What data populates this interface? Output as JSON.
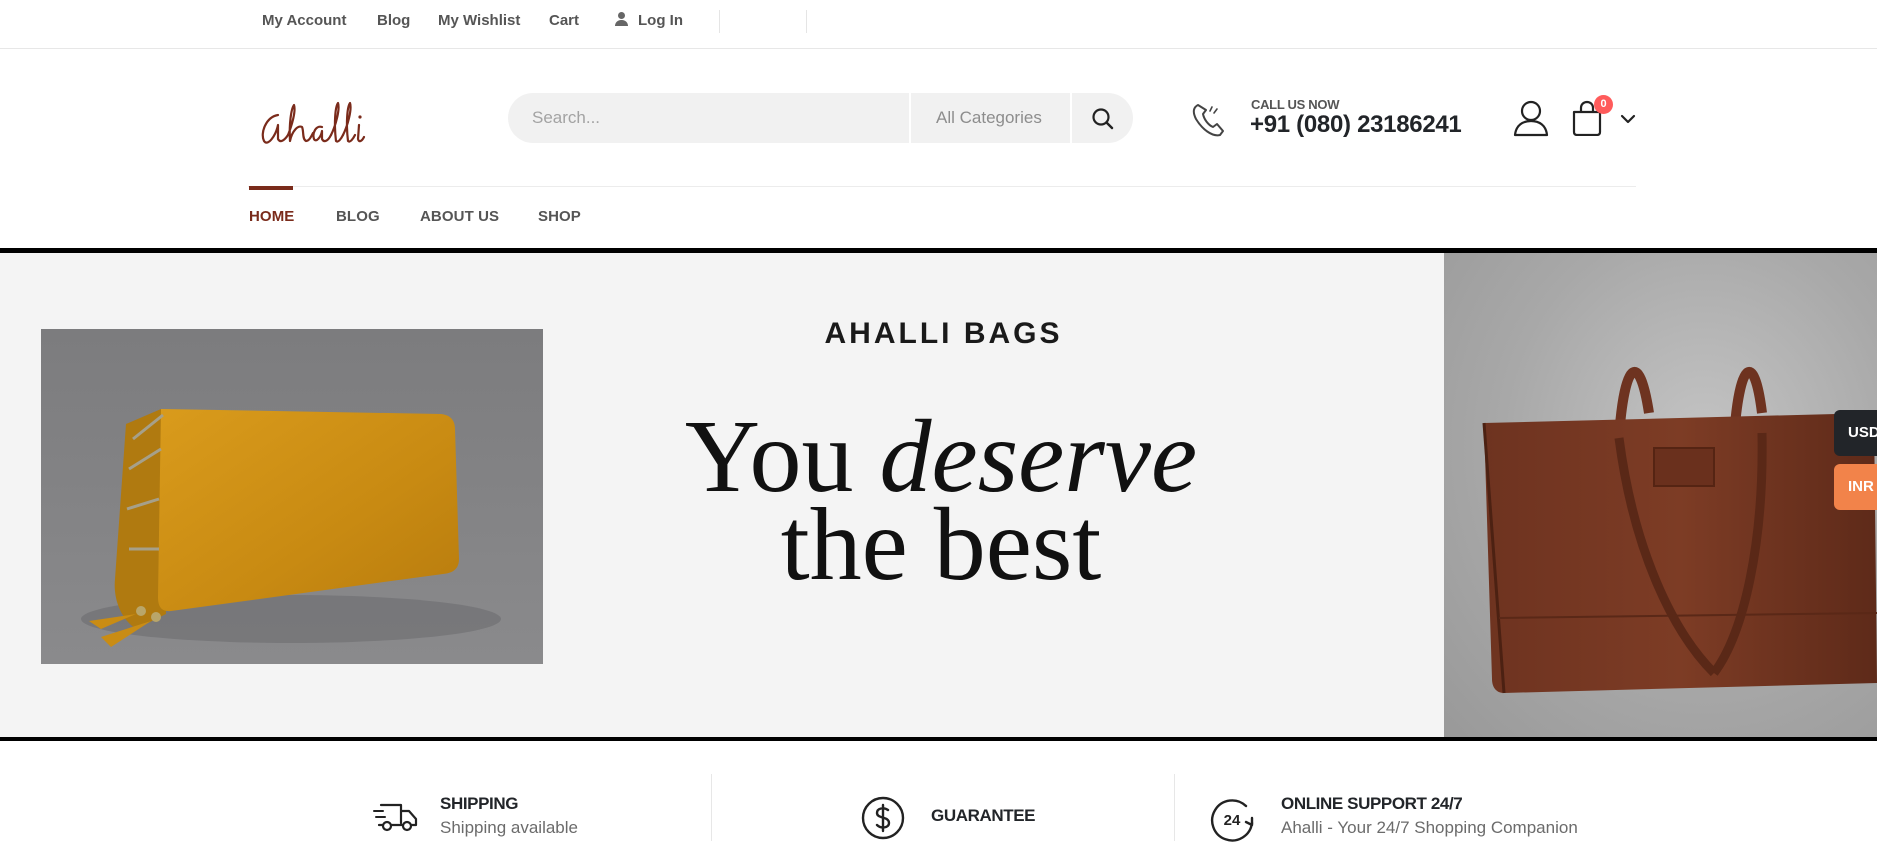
{
  "topbar": {
    "links": [
      "My Account",
      "Blog",
      "My Wishlist",
      "Cart"
    ],
    "login": "Log In"
  },
  "header": {
    "logo_text": "ahalli",
    "search": {
      "placeholder": "Search...",
      "category": "All Categories"
    },
    "call": {
      "label": "CALL US NOW",
      "number": "+91 (080) 23186241"
    },
    "cart_count": "0"
  },
  "nav": {
    "items": [
      "HOME",
      "BLOG",
      "ABOUT US",
      "SHOP"
    ],
    "active": "HOME"
  },
  "banner": {
    "brand": "AHALLI BAGS",
    "headline_1": "You",
    "headline_em": "deserve",
    "headline_2": "the best"
  },
  "currency": [
    "USD",
    "INR"
  ],
  "features": [
    {
      "title": "SHIPPING",
      "subtitle": "Shipping available",
      "icon": "truck-icon"
    },
    {
      "title": "GUARANTEE",
      "subtitle": "",
      "icon": "dollar-circle-icon"
    },
    {
      "title": "ONLINE SUPPORT 24/7",
      "subtitle": "Ahalli - Your 24/7 Shopping Companion",
      "icon": "support-24-icon",
      "icon_text": "24"
    }
  ],
  "colors": {
    "brand": "#7a2b1b",
    "badge": "#ff5b5b",
    "inr": "#f2834a",
    "usd": "#222529"
  }
}
